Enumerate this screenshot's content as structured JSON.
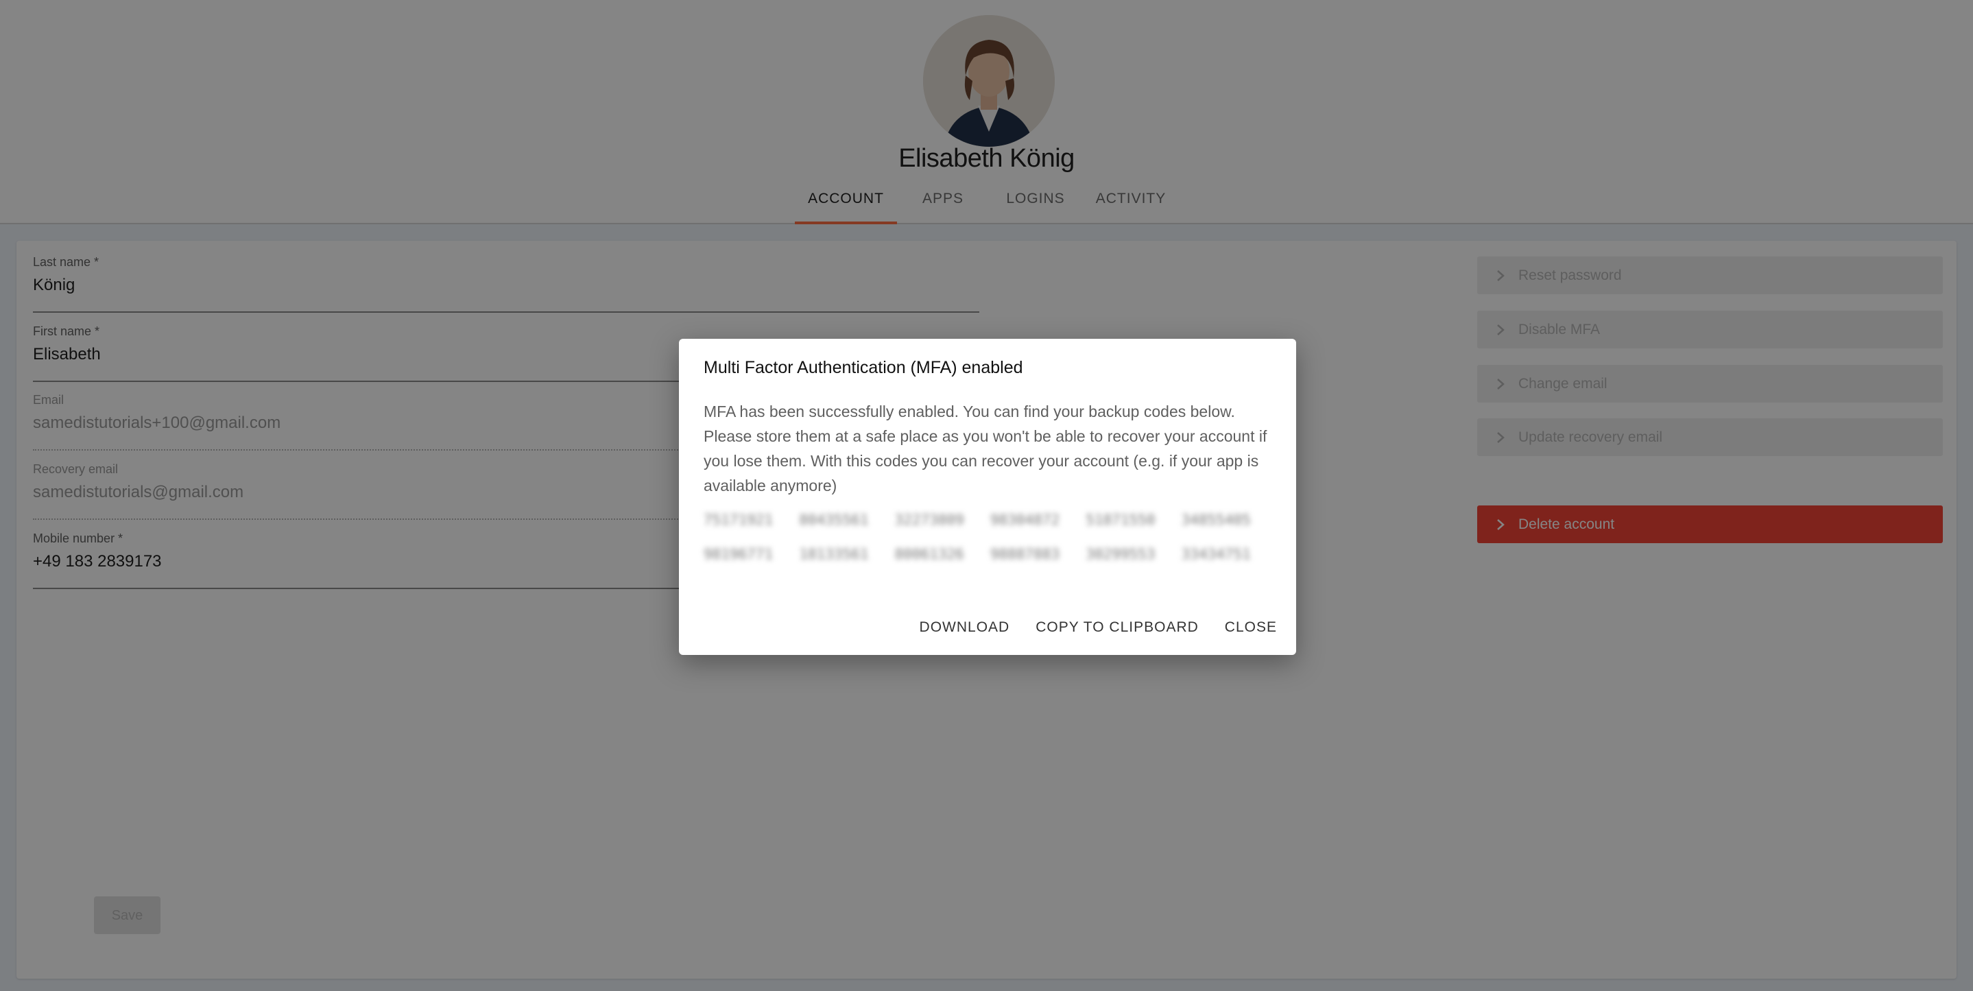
{
  "profile": {
    "name": "Elisabeth König"
  },
  "tabs": [
    {
      "label": "ACCOUNT",
      "active": true
    },
    {
      "label": "APPS"
    },
    {
      "label": "LOGINS"
    },
    {
      "label": "ACTIVITY"
    }
  ],
  "form": {
    "last_name": {
      "label": "Last name *",
      "value": "König"
    },
    "first_name": {
      "label": "First name *",
      "value": "Elisabeth"
    },
    "email": {
      "label": "Email",
      "value": "samedistutorials+100@gmail.com"
    },
    "recovery_email": {
      "label": "Recovery email",
      "value": "samedistutorials@gmail.com"
    },
    "mobile": {
      "label": "Mobile number *",
      "value": "+49 183 2839173"
    },
    "save_label": "Save"
  },
  "actions": {
    "reset_password": "Reset password",
    "disable_mfa": "Disable MFA",
    "change_email": "Change email",
    "update_recovery_email": "Update recovery email",
    "delete_account": "Delete account"
  },
  "dialog": {
    "title": "Multi Factor Authentication (MFA) enabled",
    "body": "MFA has been successfully enabled. You can find your backup codes below. Please store them at a safe place as you won't be able to recover your account if you lose them. With this codes you can recover your account (e.g. if your app is available anymore)",
    "codes": [
      "75171921",
      "80435561",
      "32273809",
      "98304872",
      "51871550",
      "34855405",
      "98196771",
      "18133561",
      "80061326",
      "98887883",
      "30299553",
      "33434751"
    ],
    "download_label": "DOWNLOAD",
    "copy_label": "COPY TO CLIPBOARD",
    "close_label": "CLOSE"
  },
  "colors": {
    "accent": "#ff7043",
    "danger": "#f44336",
    "overlay": "rgba(0,0,0,0.48)"
  }
}
